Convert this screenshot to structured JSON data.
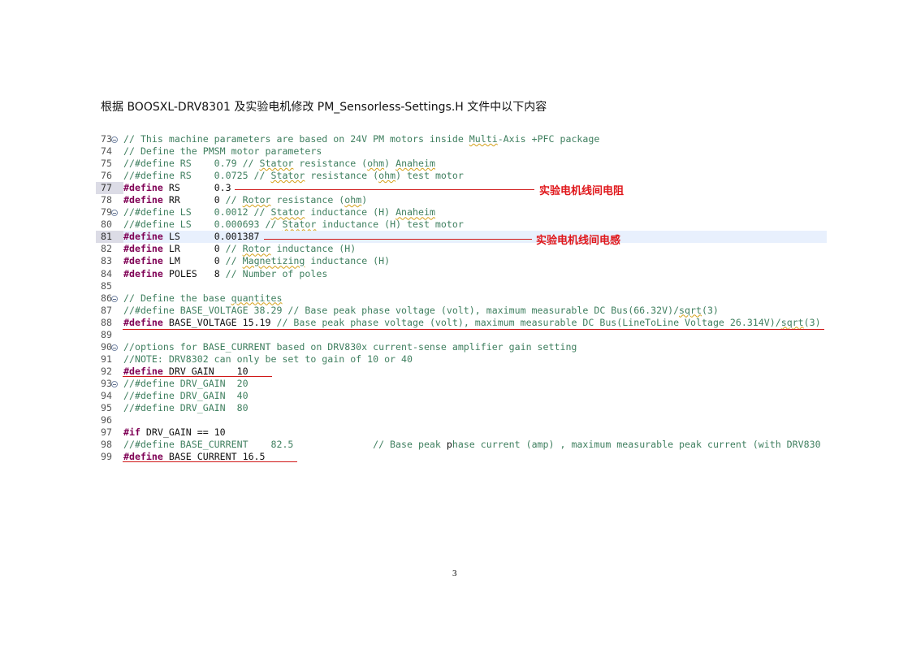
{
  "heading": "根据 BOOSXL-DRV8301 及实验电机修改 PM_Sensorless-Settings.H 文件中以下内容",
  "page_number": "3",
  "notes": {
    "rs": "实验电机线间电阻",
    "ls": "实验电机线间电感"
  },
  "code_lines": [
    {
      "num": "73",
      "fold": true,
      "parts": [
        {
          "t": "// This machine parameters are based on 24V PM motors inside ",
          "c": "cm"
        },
        {
          "t": "Multi",
          "c": "cm sq"
        },
        {
          "t": "-Axis +PFC package",
          "c": "cm"
        }
      ]
    },
    {
      "num": "74",
      "parts": [
        {
          "t": "// Define the PMSM motor parameters",
          "c": "cm"
        }
      ]
    },
    {
      "num": "75",
      "parts": [
        {
          "t": "//#define RS    0.79 // ",
          "c": "cm"
        },
        {
          "t": "Stator",
          "c": "cm sq"
        },
        {
          "t": " resistance (",
          "c": "cm"
        },
        {
          "t": "ohm",
          "c": "cm sq"
        },
        {
          "t": ") ",
          "c": "cm"
        },
        {
          "t": "Anaheim",
          "c": "cm sq"
        }
      ]
    },
    {
      "num": "76",
      "parts": [
        {
          "t": "//#define RS    0.0725 // ",
          "c": "cm"
        },
        {
          "t": "Stator",
          "c": "cm sq"
        },
        {
          "t": " resistance (",
          "c": "cm"
        },
        {
          "t": "ohm",
          "c": "cm sq"
        },
        {
          "t": ") test motor",
          "c": "cm"
        }
      ]
    },
    {
      "num": "77",
      "cur": true,
      "parts": [
        {
          "t": "#define",
          "c": "kw"
        },
        {
          "t": " RS      0.3",
          "c": "nm"
        }
      ]
    },
    {
      "num": "78",
      "parts": [
        {
          "t": "#define",
          "c": "kw"
        },
        {
          "t": " RR      0 ",
          "c": "nm"
        },
        {
          "t": "// ",
          "c": "cm"
        },
        {
          "t": "Rotor",
          "c": "cm sq"
        },
        {
          "t": " resistance (",
          "c": "cm"
        },
        {
          "t": "ohm",
          "c": "cm sq"
        },
        {
          "t": ")",
          "c": "cm"
        }
      ]
    },
    {
      "num": "79",
      "fold": true,
      "parts": [
        {
          "t": "//#define LS    0.0012 // ",
          "c": "cm"
        },
        {
          "t": "Stator",
          "c": "cm sq"
        },
        {
          "t": " inductance (H) ",
          "c": "cm"
        },
        {
          "t": "Anaheim",
          "c": "cm sq"
        }
      ]
    },
    {
      "num": "80",
      "parts": [
        {
          "t": "//#define LS    0.000693 // ",
          "c": "cm"
        },
        {
          "t": "Stator",
          "c": "cm sq"
        },
        {
          "t": " inductance (H) test motor",
          "c": "cm"
        }
      ]
    },
    {
      "num": "81",
      "cur": true,
      "hl": true,
      "parts": [
        {
          "t": "#define",
          "c": "kw"
        },
        {
          "t": " LS      0.001387",
          "c": "nm"
        }
      ]
    },
    {
      "num": "82",
      "parts": [
        {
          "t": "#define",
          "c": "kw"
        },
        {
          "t": " LR      0 ",
          "c": "nm"
        },
        {
          "t": "// ",
          "c": "cm"
        },
        {
          "t": "Rotor",
          "c": "cm sq"
        },
        {
          "t": " inductance (H)",
          "c": "cm"
        }
      ]
    },
    {
      "num": "83",
      "parts": [
        {
          "t": "#define",
          "c": "kw"
        },
        {
          "t": " LM      0 ",
          "c": "nm"
        },
        {
          "t": "// ",
          "c": "cm"
        },
        {
          "t": "Magnetizing",
          "c": "cm sq"
        },
        {
          "t": " inductance (H)",
          "c": "cm"
        }
      ]
    },
    {
      "num": "84",
      "parts": [
        {
          "t": "#define",
          "c": "kw"
        },
        {
          "t": " POLES   8 ",
          "c": "nm"
        },
        {
          "t": "// Number of poles",
          "c": "cm"
        }
      ]
    },
    {
      "num": "85",
      "parts": []
    },
    {
      "num": "86",
      "fold": true,
      "parts": [
        {
          "t": "// Define the base ",
          "c": "cm"
        },
        {
          "t": "quantites",
          "c": "cm sq"
        }
      ]
    },
    {
      "num": "87",
      "parts": [
        {
          "t": "//#define BASE_VOLTAGE 38.29 // Base peak phase voltage (volt), maximum measurable DC Bus(66.32V)/",
          "c": "cm"
        },
        {
          "t": "sqrt",
          "c": "cm sq"
        },
        {
          "t": "(3)",
          "c": "cm"
        }
      ]
    },
    {
      "num": "88",
      "parts": [
        {
          "t": "#define",
          "c": "kw"
        },
        {
          "t": " BASE_VOLTAGE 15.19 ",
          "c": "nm"
        },
        {
          "t": "// Base peak phase voltage (volt), maximum measurable DC Bus(LineToLine Voltage 26.314V)/",
          "c": "cm"
        },
        {
          "t": "sqrt",
          "c": "cm sq"
        },
        {
          "t": "(3)",
          "c": "cm"
        }
      ]
    },
    {
      "num": "89",
      "parts": []
    },
    {
      "num": "90",
      "fold": true,
      "parts": [
        {
          "t": "//options for BASE_CURRENT based on DRV830x current-sense amplifier gain setting",
          "c": "cm"
        }
      ]
    },
    {
      "num": "91",
      "parts": [
        {
          "t": "//NOTE: DRV8302 can only be set to gain of 10 or 40",
          "c": "cm"
        }
      ]
    },
    {
      "num": "92",
      "parts": [
        {
          "t": "#define",
          "c": "kw"
        },
        {
          "t": " DRV_GAIN    10",
          "c": "nm"
        }
      ]
    },
    {
      "num": "93",
      "fold": true,
      "parts": [
        {
          "t": "//#define DRV_GAIN  20",
          "c": "cm"
        }
      ]
    },
    {
      "num": "94",
      "parts": [
        {
          "t": "//#define DRV_GAIN  40",
          "c": "cm"
        }
      ]
    },
    {
      "num": "95",
      "parts": [
        {
          "t": "//#define DRV_GAIN  80",
          "c": "cm"
        }
      ]
    },
    {
      "num": "96",
      "parts": []
    },
    {
      "num": "97",
      "parts": [
        {
          "t": "#if",
          "c": "kw"
        },
        {
          "t": " DRV_GAIN == 10",
          "c": "nm"
        }
      ]
    },
    {
      "num": "98",
      "parts": [
        {
          "t": "//#define BASE_CURRENT    82.5              // Base peak ",
          "c": "cm"
        },
        {
          "t": "p",
          "c": "nm"
        },
        {
          "t": "hase current (amp) , maximum measurable peak current (with DRV830",
          "c": "cm"
        }
      ]
    },
    {
      "num": "99",
      "parts": [
        {
          "t": "#define",
          "c": "kw"
        },
        {
          "t": " BASE_CURRENT 16.5",
          "c": "nm"
        }
      ]
    }
  ]
}
